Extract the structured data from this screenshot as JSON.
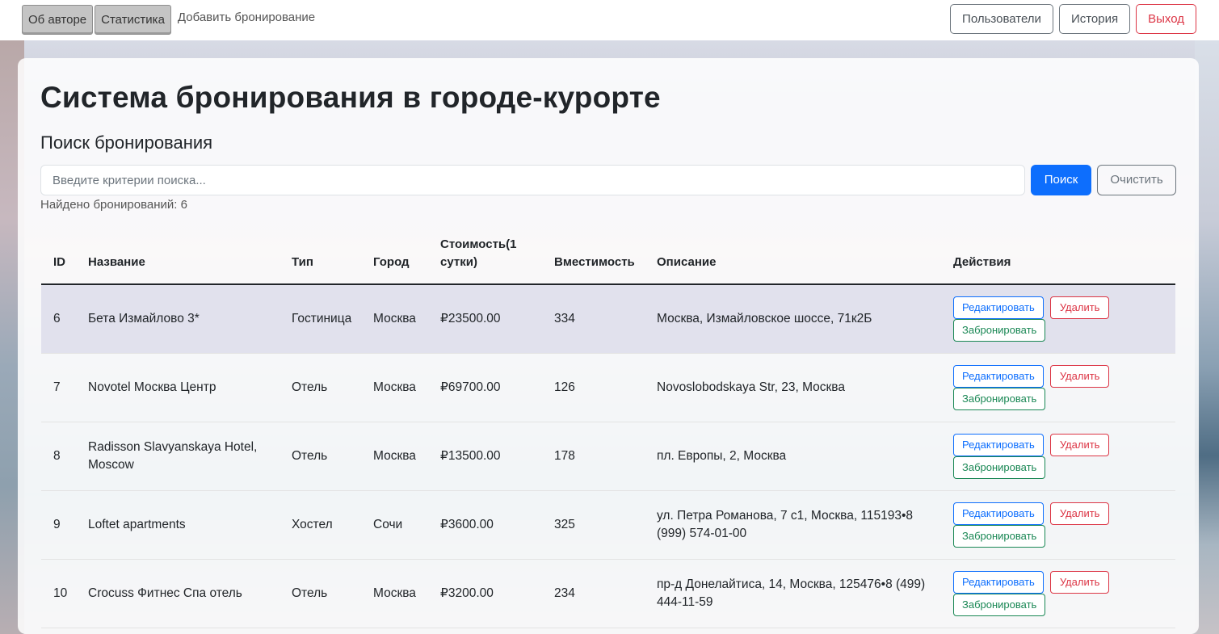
{
  "nav": {
    "about": "Об авторе",
    "stats": "Статистика",
    "add_booking": "Добавить бронирование",
    "users": "Пользователи",
    "history": "История",
    "logout": "Выход"
  },
  "page": {
    "title": "Система бронирования в городе-курорте",
    "search_heading": "Поиск бронирования"
  },
  "search": {
    "placeholder": "Введите критерии поиска...",
    "value": "",
    "search_label": "Поиск",
    "clear_label": "Очистить",
    "found_text": "Найдено бронирований: 6"
  },
  "table": {
    "headers": {
      "id": "ID",
      "name": "Название",
      "type": "Тип",
      "city": "Город",
      "price": "Стоимость(1 сутки)",
      "capacity": "Вместимость",
      "description": "Описание",
      "actions": "Действия"
    },
    "action_labels": {
      "edit": "Редактировать",
      "delete": "Удалить",
      "book": "Забронировать"
    },
    "rows": [
      {
        "id": "6",
        "name": "Бета Измайлово 3*",
        "type": "Гостиница",
        "city": "Москва",
        "price": "₽23500.00",
        "capacity": "334",
        "description": "Москва, Измайловское шоссе, 71к2Б"
      },
      {
        "id": "7",
        "name": "Novotel Москва Центр",
        "type": "Отель",
        "city": "Москва",
        "price": "₽69700.00",
        "capacity": "126",
        "description": "Novoslobodskaya Str, 23, Москва"
      },
      {
        "id": "8",
        "name": "Radisson Slavyanskaya Hotel, Moscow",
        "type": "Отель",
        "city": "Москва",
        "price": "₽13500.00",
        "capacity": "178",
        "description": "пл. Европы, 2, Москва"
      },
      {
        "id": "9",
        "name": "Loftet apartments",
        "type": "Хостел",
        "city": "Сочи",
        "price": "₽3600.00",
        "capacity": "325",
        "description": "ул. Петра Романова, 7 с1, Москва, 115193•8 (999) 574-01-00"
      },
      {
        "id": "10",
        "name": "Crocuss Фитнес Спа отель",
        "type": "Отель",
        "city": "Москва",
        "price": "₽3200.00",
        "capacity": "234",
        "description": "пр-д Донелайтиса, 14, Москва, 125476•8 (499) 444-11-59"
      }
    ]
  }
}
